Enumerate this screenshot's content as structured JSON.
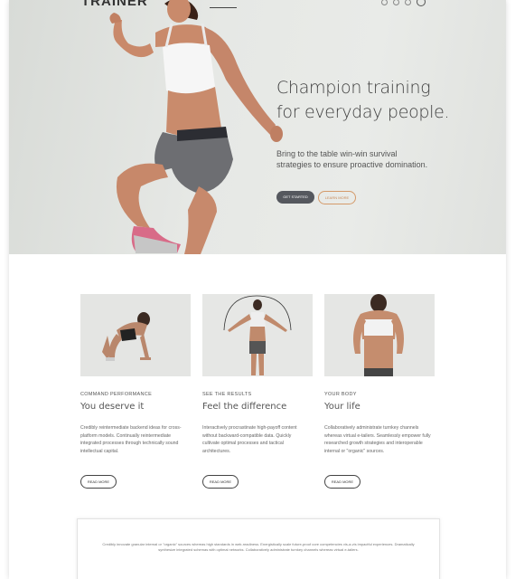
{
  "brand": {
    "logo": "TRAINER"
  },
  "nav": {
    "items": [
      "",
      "",
      "",
      "",
      "",
      ""
    ]
  },
  "hero": {
    "title_line1": "Champion training",
    "title_line2": "for everyday people.",
    "subtitle": "Bring to the table win-win survival strategies to ensure proactive domination.",
    "primary_button": "GET STARTED",
    "secondary_button": "LEARN MORE"
  },
  "cards": [
    {
      "kicker": "COMMAND PERFORMANCE",
      "title": "You deserve it",
      "body": "Credibly reintermediate backend ideas for cross-platform models. Continually reintermediate integrated processes through technically sound intellectual capital.",
      "button": "READ MORE"
    },
    {
      "kicker": "SEE THE RESULTS",
      "title": "Feel the difference",
      "body": "Interactively procrastinate high-payoff content without backward-compatible data. Quickly cultivate optimal processes and tactical architectures.",
      "button": "READ MORE"
    },
    {
      "kicker": "YOUR BODY",
      "title": "Your life",
      "body": "Collaboratively administrate turnkey channels whereas virtual e-tailers. Seamlessly empower fully researched growth strategies and interoperable internal or \"organic\" sources.",
      "button": "READ MORE"
    }
  ],
  "quote": {
    "text": "Credibly innovate granular internal or \"organic\" sources whereas high standards in web-readiness. Energistically scale future-proof core competencies vis-a-vis impactful experiences. Dramatically synthesize integrated schemas with optimal networks. Collaboratively administrate turnkey channels whereas virtual e-tailers."
  }
}
